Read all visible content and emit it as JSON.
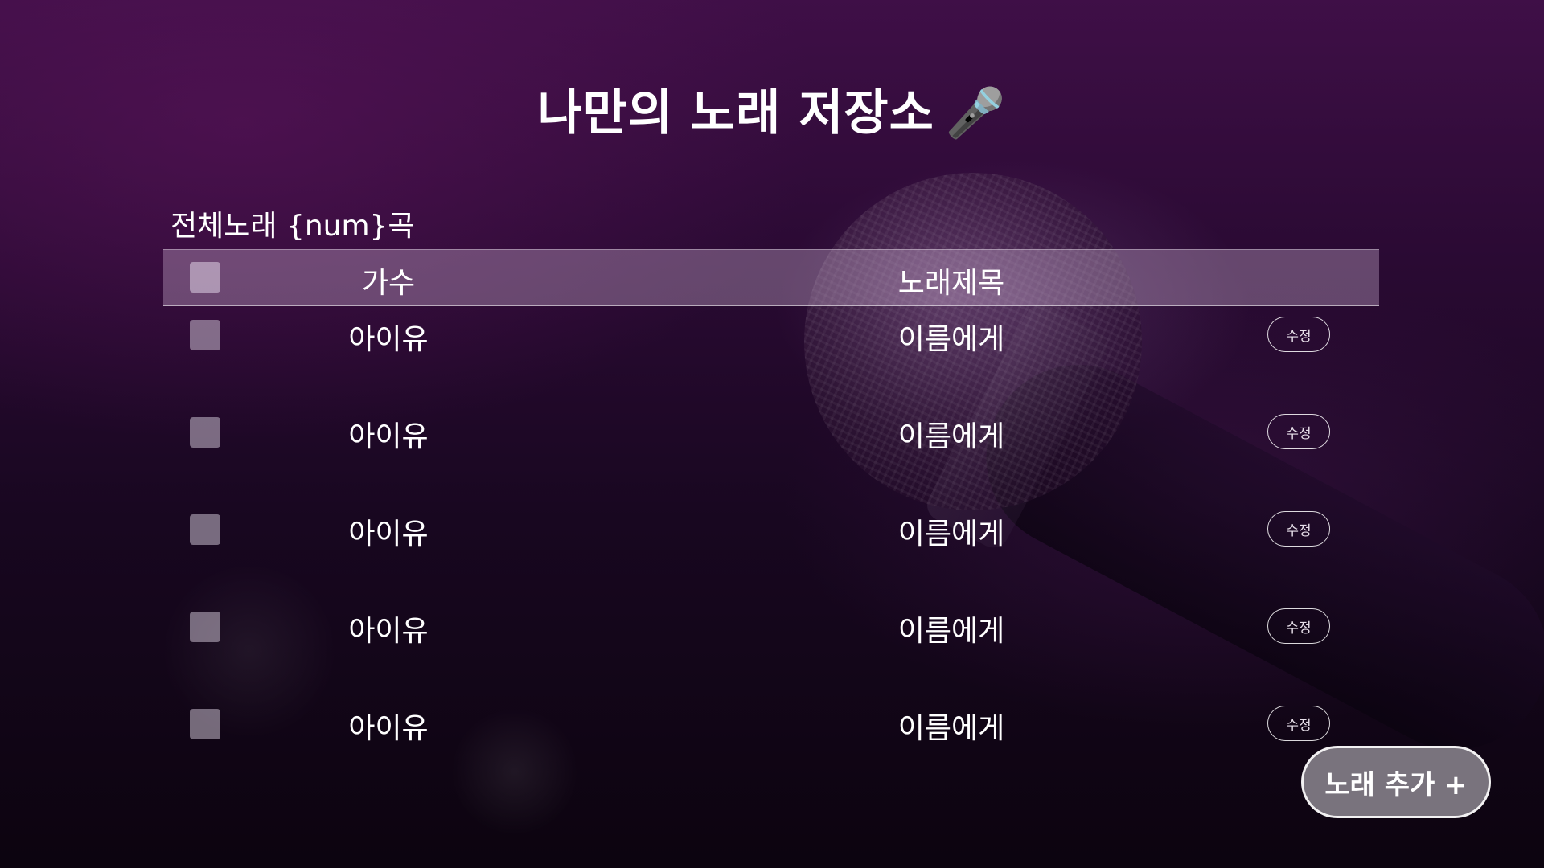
{
  "header": {
    "title": "나만의 노래 저장소",
    "title_emoji": "🎤"
  },
  "summary": {
    "count_label": "전체노래 {num}곡"
  },
  "table": {
    "columns": {
      "artist": "가수",
      "song_title": "노래제목"
    },
    "rows": [
      {
        "artist": "아이유",
        "song_title": "이름에게",
        "edit_label": "수정"
      },
      {
        "artist": "아이유",
        "song_title": "이름에게",
        "edit_label": "수정"
      },
      {
        "artist": "아이유",
        "song_title": "이름에게",
        "edit_label": "수정"
      },
      {
        "artist": "아이유",
        "song_title": "이름에게",
        "edit_label": "수정"
      },
      {
        "artist": "아이유",
        "song_title": "이름에게",
        "edit_label": "수정"
      }
    ]
  },
  "actions": {
    "add_song_label": "노래 추가 +"
  },
  "colors": {
    "background_top": "#3f0f47",
    "background_bottom": "#0c040f",
    "header_row": "#9d7fa3",
    "add_button": "#827d87"
  }
}
